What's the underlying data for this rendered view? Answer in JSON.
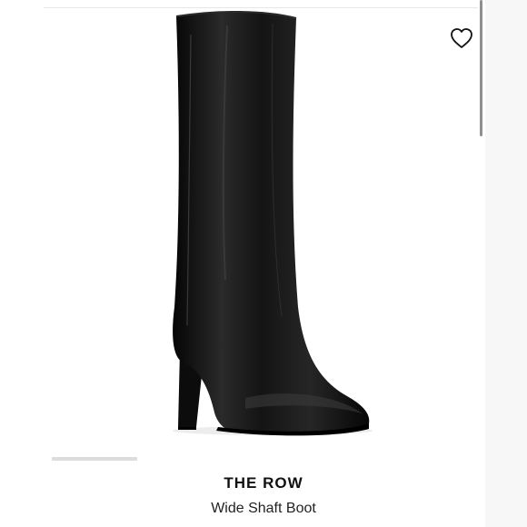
{
  "product": {
    "brand": "THE ROW",
    "name": "Wide Shaft Boot",
    "image_alt": "black leather knee-high boot with block heel",
    "image_index": 1,
    "image_count": 5
  },
  "icons": {
    "wishlist": "heart-outline-icon"
  },
  "colors": {
    "boot": "#121212",
    "text": "#111111",
    "scrollbar": "#8f8f8f"
  }
}
